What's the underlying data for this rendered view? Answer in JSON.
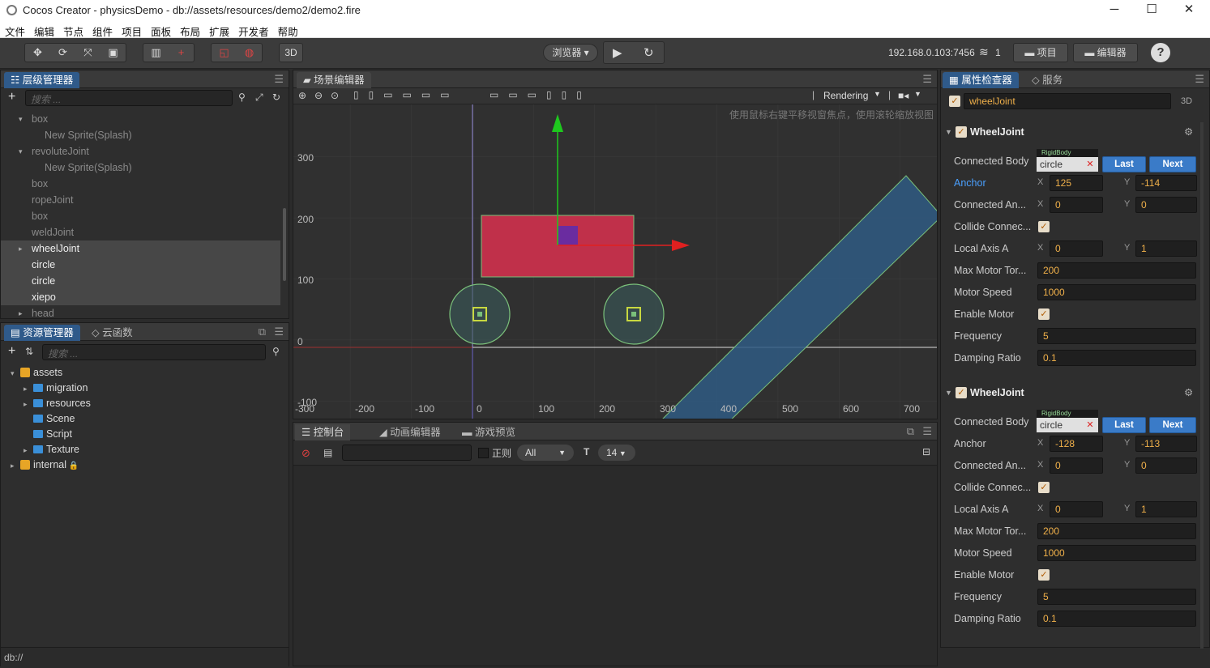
{
  "window": {
    "title": "Cocos Creator - physicsDemo - db://assets/resources/demo2/demo2.fire",
    "minimize": "─",
    "maximize": "☐",
    "close": "✕"
  },
  "menu": [
    "文件",
    "编辑",
    "节点",
    "组件",
    "项目",
    "面板",
    "布局",
    "扩展",
    "开发者",
    "帮助"
  ],
  "toolbar": {
    "mode_3d": "3D",
    "browser": "浏览器 ▾",
    "play": "▶",
    "refresh": "↻",
    "ip": "192.168.0.103:7456",
    "clients": "1",
    "project_btn": "项目",
    "editor_btn": "编辑器",
    "help": "?"
  },
  "hierarchy": {
    "title": "层级管理器",
    "search_placeholder": "搜索 ...",
    "nodes": [
      {
        "label": "box",
        "indent": 1,
        "arrow": "▾",
        "dim": true
      },
      {
        "label": "New Sprite(Splash)",
        "indent": 2,
        "dim": true
      },
      {
        "label": "revoluteJoint",
        "indent": 1,
        "arrow": "▾",
        "dim": true
      },
      {
        "label": "New Sprite(Splash)",
        "indent": 2,
        "dim": true
      },
      {
        "label": "box",
        "indent": 1,
        "dim": true
      },
      {
        "label": "ropeJoint",
        "indent": 1,
        "dim": true
      },
      {
        "label": "box",
        "indent": 1,
        "dim": true
      },
      {
        "label": "weldJoint",
        "indent": 1,
        "dim": true
      },
      {
        "label": "wheelJoint",
        "indent": 1,
        "arrow": "▸",
        "dim": false,
        "sel": true
      },
      {
        "label": "circle",
        "indent": 1,
        "dim": false,
        "sel": true
      },
      {
        "label": "circle",
        "indent": 1,
        "dim": false,
        "sel": true
      },
      {
        "label": "xiepo",
        "indent": 1,
        "dim": false,
        "sel": true
      },
      {
        "label": "head",
        "indent": 1,
        "arrow": "▸",
        "dim": true
      }
    ]
  },
  "assets": {
    "title": "资源管理器",
    "tab2": "云函数",
    "search_placeholder": "搜索 ...",
    "items": [
      {
        "label": "assets",
        "level": 0,
        "arrow": "▾",
        "color": "yellow"
      },
      {
        "label": "migration",
        "level": 1,
        "arrow": "▸",
        "color": "blue"
      },
      {
        "label": "resources",
        "level": 1,
        "arrow": "▸",
        "color": "blue"
      },
      {
        "label": "Scene",
        "level": 1,
        "arrow": "",
        "color": "blue"
      },
      {
        "label": "Script",
        "level": 1,
        "arrow": "",
        "color": "blue"
      },
      {
        "label": "Texture",
        "level": 1,
        "arrow": "▸",
        "color": "blue"
      },
      {
        "label": "internal",
        "level": 0,
        "arrow": "▸",
        "color": "yellow"
      }
    ],
    "footer": "db://"
  },
  "scene": {
    "title": "场景编辑器",
    "rendering": "Rendering",
    "hint": "使用鼠标右键平移视窗焦点，使用滚轮缩放视图",
    "y_ticks": [
      "300",
      "200",
      "100",
      "0",
      "-100"
    ],
    "x_ticks": [
      "-300",
      "-200",
      "-100",
      "0",
      "100",
      "200",
      "300",
      "400",
      "500",
      "600",
      "700"
    ]
  },
  "console": {
    "tab1": "控制台",
    "tab2": "动画编辑器",
    "tab3": "游戏预览",
    "regex": "正则",
    "level": "All",
    "font_size": "14"
  },
  "inspector": {
    "title": "属性检查器",
    "tab2": "服务",
    "node_name": "wheelJoint",
    "mode": "3D",
    "components": [
      {
        "name": "WheelJoint",
        "rigid_tag": "RigidBody",
        "connected_body": "circle",
        "last": "Last",
        "next": "Next",
        "labels": {
          "connected_body": "Connected Body",
          "anchor": "Anchor",
          "connected_anchor": "Connected An...",
          "collide": "Collide Connec...",
          "local_axis": "Local Axis A",
          "max_motor": "Max Motor Tor...",
          "motor_speed": "Motor Speed",
          "enable_motor": "Enable Motor",
          "frequency": "Frequency",
          "damping": "Damping Ratio"
        },
        "anchor_x": "125",
        "anchor_y": "-114",
        "ca_x": "0",
        "ca_y": "0",
        "axis_x": "0",
        "axis_y": "1",
        "max_motor": "200",
        "motor_speed": "1000",
        "frequency": "5",
        "damping": "0.1"
      },
      {
        "name": "WheelJoint",
        "rigid_tag": "RigidBody",
        "connected_body": "circle",
        "last": "Last",
        "next": "Next",
        "labels": {
          "connected_body": "Connected Body",
          "anchor": "Anchor",
          "connected_anchor": "Connected An...",
          "collide": "Collide Connec...",
          "local_axis": "Local Axis A",
          "max_motor": "Max Motor Tor...",
          "motor_speed": "Motor Speed",
          "enable_motor": "Enable Motor",
          "frequency": "Frequency",
          "damping": "Damping Ratio"
        },
        "anchor_x": "-128",
        "anchor_y": "-113",
        "ca_x": "0",
        "ca_y": "0",
        "axis_x": "0",
        "axis_y": "1",
        "max_motor": "200",
        "motor_speed": "1000",
        "frequency": "5",
        "damping": "0.1"
      }
    ]
  },
  "colors": {
    "accent": "#2f5a8a",
    "body": "#c0304a",
    "joint": "#6a2ca0",
    "incline": "#2f5a82",
    "wheel": "#3a5a5a"
  }
}
